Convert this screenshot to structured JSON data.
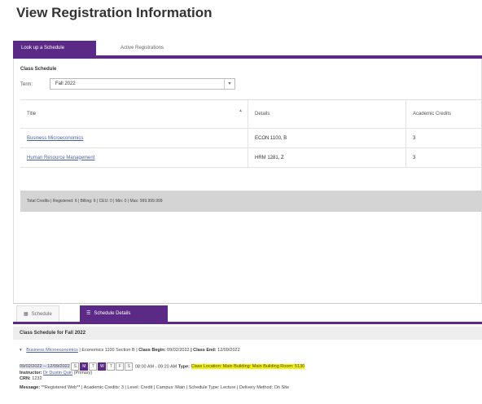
{
  "page": {
    "title": "View Registration Information"
  },
  "tabs": [
    {
      "label": "Look up a Schedule",
      "active": true
    },
    {
      "label": "Active Registrations",
      "active": false
    }
  ],
  "schedule": {
    "section_label": "Class Schedule",
    "term_label": "Term:",
    "term_value": "Fall 2022",
    "columns": [
      "Title",
      "Details",
      "Academic Credits"
    ],
    "rows": [
      {
        "title": "Business Microeconomics",
        "details": "ECON 1100, B",
        "credits": "3"
      },
      {
        "title": "Human Resource Management",
        "details": "HRM 1281, Z",
        "credits": "3"
      }
    ],
    "totals": "Total Credits | Registered: 6 | Billing: 6 | CEU: 0 | Min: 0 | Max: 999.999.999"
  },
  "bottom": {
    "tabs": [
      {
        "label": "Schedule",
        "icon": "calendar-icon",
        "active": false
      },
      {
        "label": "Schedule Details",
        "icon": "list-icon",
        "active": true
      }
    ],
    "header": "Class Schedule for Fall 2022",
    "course": {
      "title": "Business Microeconomics",
      "section_info": "| Economics 1100 Section B |",
      "class_begin_label": "Class Begin:",
      "class_begin": "09/02/2022",
      "class_end_label": "| Class End:",
      "class_end": "12/09/2022"
    },
    "meeting": {
      "dates": "09/02/2022 -- 12/09/2022",
      "days": [
        "S",
        "M",
        "T",
        "W",
        "T",
        "F",
        "S"
      ],
      "time": "08:00 AM - 09:20 AM",
      "type_label": "Type:",
      "location": "Class Location: Main Building: Main Building Room: 5130"
    },
    "instructor_label": "Instructor:",
    "instructor_name": "Dr Dustin Quin",
    "instructor_role": "(Primary)",
    "crn_label": "CRN:",
    "crn_value": "1232",
    "message": {
      "label": "Message:",
      "text": "**Registered Web** | Academic Credits: 3 | Level: Credit | Campus: Main | Schedule Type: Lecture | Delivery Method: On Site"
    }
  }
}
